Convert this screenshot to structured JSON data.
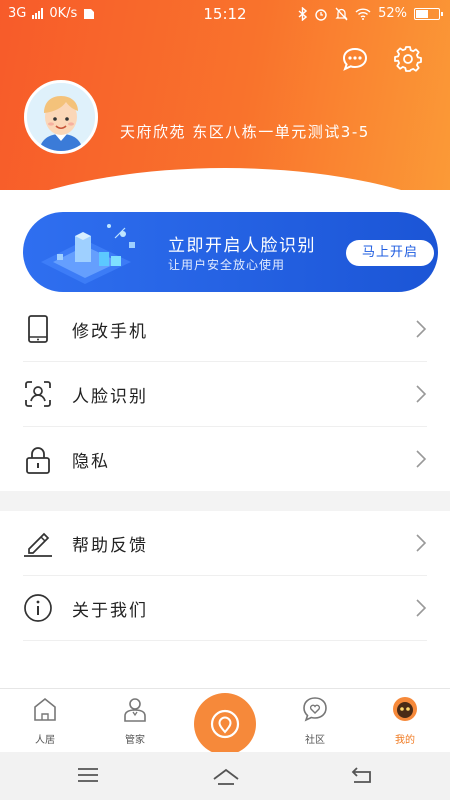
{
  "status_bar": {
    "network": "3G",
    "speed": "0K/s",
    "time": "15:12",
    "battery": "52%"
  },
  "header": {
    "address": "天府欣苑 东区八栋一单元测试3-5",
    "icons": [
      "chat-icon",
      "settings-icon"
    ]
  },
  "banner": {
    "title": "立即开启人脸识别",
    "subtitle": "让用户安全放心使用",
    "button": "马上开启"
  },
  "menu_group_1": [
    {
      "label": "修改手机",
      "icon": "phone-icon"
    },
    {
      "label": "人脸识别",
      "icon": "face-scan-icon"
    },
    {
      "label": "隐私",
      "icon": "lock-icon"
    }
  ],
  "menu_group_2": [
    {
      "label": "帮助反馈",
      "icon": "pencil-icon"
    },
    {
      "label": "关于我们",
      "icon": "info-icon"
    }
  ],
  "tabbar": {
    "tabs": [
      {
        "label": "人居",
        "icon": "home-icon"
      },
      {
        "label": "管家",
        "icon": "butler-icon"
      },
      {
        "label": "社区",
        "icon": "community-icon"
      },
      {
        "label": "我的",
        "icon": "profile-icon",
        "active": true
      }
    ],
    "accent": "#f07a21"
  },
  "colors": {
    "header_start": "#f75b2a",
    "header_end": "#fb9a37",
    "banner": "#2f6ff0",
    "center_button": "#f6893a"
  }
}
